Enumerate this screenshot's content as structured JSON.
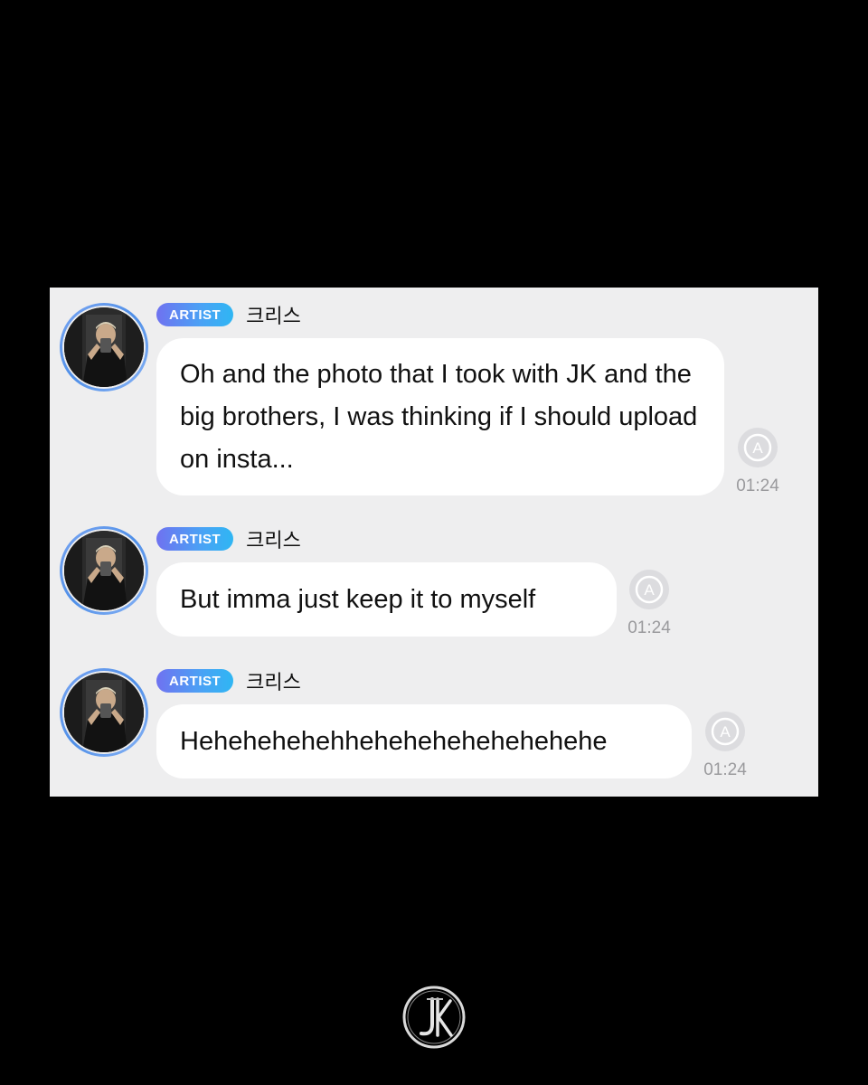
{
  "messages": [
    {
      "badge": "ARTIST",
      "sender": "크리스",
      "text": "Oh and the photo that I took with JK and the big brothers, I was thinking if I should upload on insta...",
      "time": "01:24",
      "status_icon": "auto-translate-icon"
    },
    {
      "badge": "ARTIST",
      "sender": "크리스",
      "text": "But imma just keep it to myself",
      "time": "01:24",
      "status_icon": "auto-translate-icon"
    },
    {
      "badge": "ARTIST",
      "sender": "크리스",
      "text": "Hehehehehehhehehehehehehehehe",
      "time": "01:24",
      "status_icon": "auto-translate-icon"
    }
  ],
  "footer": {
    "logo": "JK"
  },
  "colors": {
    "background": "#000000",
    "panel": "#eeeeef",
    "bubble": "#ffffff",
    "badge_start": "#6f72f0",
    "badge_end": "#2fb6f3",
    "time_text": "#9a9a9d"
  }
}
